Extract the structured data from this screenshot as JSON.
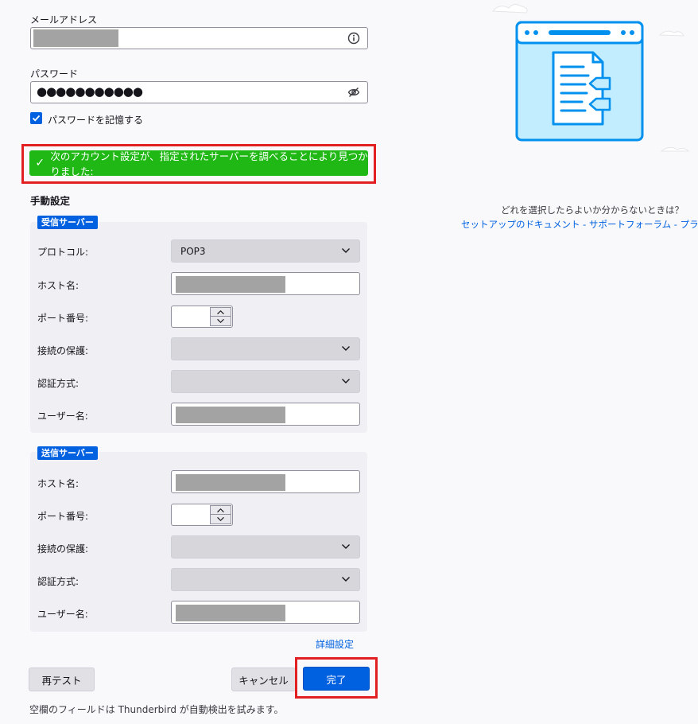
{
  "account": {
    "email_label": "メールアドレス",
    "password_label": "パスワード",
    "password_value": "●●●●●●●●●●●",
    "remember_label": "パスワードを記憶する",
    "remember_checked": true
  },
  "success_message": "次のアカウント設定が、指定されたサーバーを調べることにより見つかりました:",
  "manual": {
    "title": "手動設定",
    "incoming": {
      "badge": "受信サーバー",
      "protocol_label": "プロトコル:",
      "protocol_value": "POP3",
      "host_label": "ホスト名:",
      "port_label": "ポート番号:",
      "security_label": "接続の保護:",
      "auth_label": "認証方式:",
      "user_label": "ユーザー名:"
    },
    "outgoing": {
      "badge": "送信サーバー",
      "host_label": "ホスト名:",
      "port_label": "ポート番号:",
      "security_label": "接続の保護:",
      "auth_label": "認証方式:",
      "user_label": "ユーザー名:"
    },
    "advanced_link": "詳細設定"
  },
  "buttons": {
    "retest": "再テスト",
    "cancel": "キャンセル",
    "done": "完了"
  },
  "footnote": "空欄のフィールドは Thunderbird が自動検出を試みます。",
  "help": {
    "question": "どれを選択したらよいか分からないときは？",
    "link_docs": "セットアップのドキュメント",
    "link_forum": "サポートフォーラム",
    "link_privacy": "プライバシーポリシー",
    "separator": " - "
  },
  "icons": {
    "info": "info-icon",
    "hide_password": "eye-slash-icon",
    "check": "checkmark-icon",
    "dropdown": "chevron-down-icon",
    "illustration": "document-window-illustration"
  },
  "colors": {
    "accent": "#0061e0",
    "success": "#20b815",
    "highlight": "#e22021"
  }
}
